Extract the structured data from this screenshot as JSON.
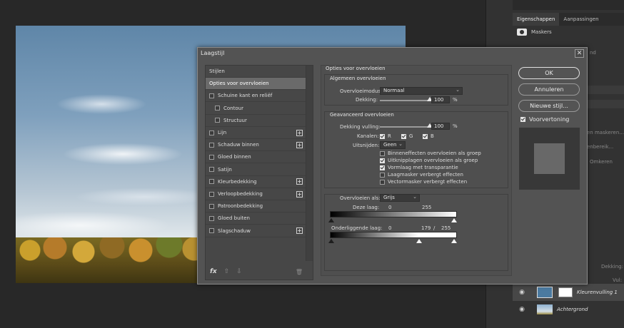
{
  "dialog": {
    "title": "Laagstijl",
    "close_glyph": "✕",
    "style_list": {
      "items": [
        {
          "label": "Stijlen",
          "checkbox": false,
          "checked": false,
          "plus": false,
          "indent": 0,
          "selected": false
        },
        {
          "label": "Opties voor overvloeien",
          "checkbox": false,
          "checked": false,
          "plus": false,
          "indent": 0,
          "selected": true
        },
        {
          "label": "Schuine kant en reliëf",
          "checkbox": true,
          "checked": false,
          "plus": false,
          "indent": 0,
          "selected": false
        },
        {
          "label": "Contour",
          "checkbox": true,
          "checked": false,
          "plus": false,
          "indent": 1,
          "selected": false
        },
        {
          "label": "Structuur",
          "checkbox": true,
          "checked": false,
          "plus": false,
          "indent": 1,
          "selected": false
        },
        {
          "label": "Lijn",
          "checkbox": true,
          "checked": false,
          "plus": true,
          "indent": 0,
          "selected": false
        },
        {
          "label": "Schaduw binnen",
          "checkbox": true,
          "checked": false,
          "plus": true,
          "indent": 0,
          "selected": false
        },
        {
          "label": "Gloed binnen",
          "checkbox": true,
          "checked": false,
          "plus": false,
          "indent": 0,
          "selected": false
        },
        {
          "label": "Satijn",
          "checkbox": true,
          "checked": false,
          "plus": false,
          "indent": 0,
          "selected": false
        },
        {
          "label": "Kleurbedekking",
          "checkbox": true,
          "checked": false,
          "plus": true,
          "indent": 0,
          "selected": false
        },
        {
          "label": "Verloopbedekking",
          "checkbox": true,
          "checked": false,
          "plus": true,
          "indent": 0,
          "selected": false
        },
        {
          "label": "Patroonbedekking",
          "checkbox": true,
          "checked": false,
          "plus": false,
          "indent": 0,
          "selected": false
        },
        {
          "label": "Gloed buiten",
          "checkbox": true,
          "checked": false,
          "plus": false,
          "indent": 0,
          "selected": false
        },
        {
          "label": "Slagschaduw",
          "checkbox": true,
          "checked": false,
          "plus": true,
          "indent": 0,
          "selected": false
        }
      ],
      "footer": {
        "fx": "fx",
        "up": "⇧",
        "down": "⇩",
        "trash": "🗑"
      }
    },
    "options": {
      "section_title": "Opties voor overvloeien",
      "general": {
        "title": "Algemeen overvloeien",
        "blend_mode_label": "Overvloeimodus:",
        "blend_mode_value": "Normaal",
        "opacity_label": "Dekking:",
        "opacity_value": "100",
        "opacity_unit": "%",
        "opacity_level": 1.0
      },
      "advanced": {
        "title": "Geavanceerd overvloeien",
        "fill_opacity_label": "Dekking vulling:",
        "fill_opacity_value": "100",
        "fill_opacity_unit": "%",
        "fill_opacity_level": 1.0,
        "channels_label": "Kanalen:",
        "channels": [
          {
            "label": "R",
            "checked": true
          },
          {
            "label": "G",
            "checked": true
          },
          {
            "label": "B",
            "checked": true
          }
        ],
        "knockout_label": "Uitsnijden:",
        "knockout_value": "Geen",
        "checks": [
          {
            "label": "Binneneffecten overvloeien als groep",
            "checked": false
          },
          {
            "label": "Uitknipplagen overvloeien als groep",
            "checked": true
          },
          {
            "label": "Vormlaag met transparantie",
            "checked": true
          },
          {
            "label": "Laagmasker verbergt effecten",
            "checked": false
          },
          {
            "label": "Vectormasker verbergt effecten",
            "checked": false
          }
        ]
      },
      "blend_if": {
        "label": "Overvloeien als:",
        "value": "Grijs",
        "this_layer_label": "Deze laag:",
        "this_layer_low": "0",
        "this_layer_high": "255",
        "underlying_label": "Onderliggende laag:",
        "underlying_low": "0",
        "underlying_mid": "179",
        "underlying_sep": "/",
        "underlying_high": "255",
        "underlying_mid_level": 0.702
      }
    },
    "buttons": {
      "ok": "OK",
      "cancel": "Annuleren",
      "new_style": "Nieuwe stijl...",
      "preview_label": "Voorvertoning",
      "preview_checked": true
    }
  },
  "right_panel": {
    "tabs": [
      "Eigenschappen",
      "Aanpassingen"
    ],
    "masks_label": "Maskers",
    "peek_texts": [
      "nd",
      "en maskeren...",
      "enbereik...",
      "Omkeren",
      "Dekking:",
      "Vul:"
    ],
    "layers": [
      {
        "name": "Kleurenvulling 1",
        "selected": true
      },
      {
        "name": "Achtergrond",
        "selected": false
      }
    ]
  },
  "colors": {
    "dialog_bg": "#535353",
    "panel_bg": "#323232",
    "selected_item": "#6a6a6a",
    "fill_layer": "#4b7aa0"
  }
}
